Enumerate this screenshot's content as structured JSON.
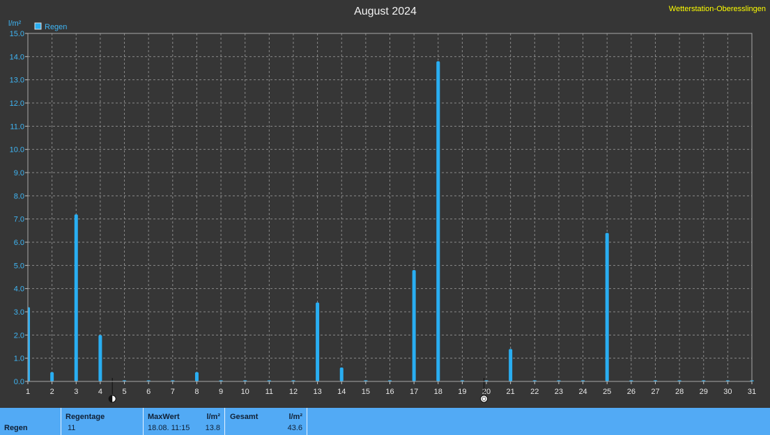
{
  "title": "August 2024",
  "station": "Wetterstation-Oberesslingen",
  "chart_data": {
    "type": "bar",
    "title": "August 2024",
    "ylabel": "l/m²",
    "ylim": [
      0,
      15
    ],
    "yticks": [
      "0.0",
      "1.0",
      "2.0",
      "3.0",
      "4.0",
      "5.0",
      "6.0",
      "7.0",
      "8.0",
      "9.0",
      "10.0",
      "11.0",
      "12.0",
      "13.0",
      "14.0",
      "15.0"
    ],
    "xlim": [
      1,
      31
    ],
    "categories": [
      "1",
      "2",
      "3",
      "4",
      "5",
      "6",
      "7",
      "8",
      "9",
      "10",
      "11",
      "12",
      "13",
      "14",
      "15",
      "16",
      "17",
      "18",
      "19",
      "20",
      "21",
      "22",
      "23",
      "24",
      "25",
      "26",
      "27",
      "28",
      "29",
      "30",
      "31"
    ],
    "legend": "top-left",
    "grid": true,
    "series": [
      {
        "name": "Regen",
        "color": "#29aef2",
        "values": [
          3.2,
          0.4,
          7.2,
          2.0,
          0,
          0,
          0,
          0.4,
          0,
          0,
          0,
          0,
          3.4,
          0.6,
          0,
          0,
          4.8,
          13.8,
          0,
          0,
          1.4,
          0,
          0,
          0,
          6.4,
          0,
          0,
          0,
          0,
          0,
          0
        ]
      }
    ],
    "moon_markers": [
      {
        "x": 4.5,
        "icon": "half-moon-icon"
      },
      {
        "x": 19.9,
        "icon": "full-moon-icon"
      }
    ]
  },
  "footer": {
    "row_label": "Regen",
    "regentage_label": "Regentage",
    "regentage_value": "11",
    "maxwert_label": "MaxWert",
    "maxwert_unit": "l/m²",
    "maxwert_date": "18.08.  11:15",
    "maxwert_value": "13.8",
    "gesamt_label": "Gesamt",
    "gesamt_unit": "l/m²",
    "gesamt_value": "43.6"
  }
}
